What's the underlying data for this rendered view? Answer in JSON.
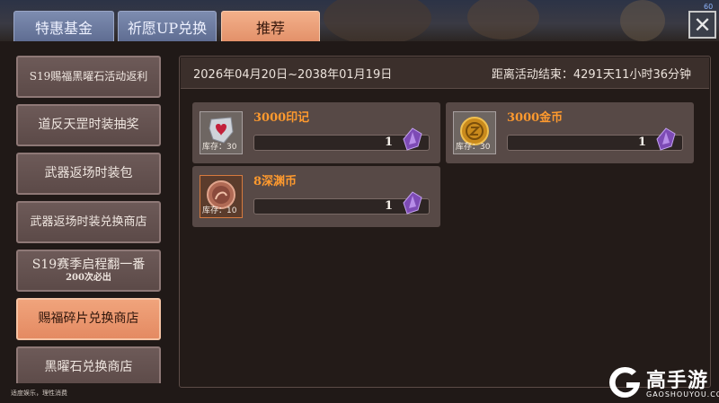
{
  "tabs": [
    {
      "label": "特惠基金",
      "active": false
    },
    {
      "label": "祈愿UP兑换",
      "active": false
    },
    {
      "label": "推荐",
      "active": true
    }
  ],
  "top_counter": "60",
  "sidebar": {
    "items": [
      {
        "label": "S19赐福黑曜石活动返利",
        "sub": ""
      },
      {
        "label": "道反天罡时装抽奖",
        "sub": ""
      },
      {
        "label": "武器返场时装包",
        "sub": ""
      },
      {
        "label": "武器返场时装兑换商店",
        "sub": ""
      },
      {
        "label": "S19赛季启程翻一番",
        "sub": "200次必出"
      },
      {
        "label": "赐福碎片兑换商店",
        "sub": "",
        "active": true
      },
      {
        "label": "黑曜石兑换商店",
        "sub": ""
      }
    ]
  },
  "footer_note": "适度娱乐，理性消费",
  "event": {
    "date_range": "2026年04月20日~2038年01月19日",
    "countdown": "距离活动结束：4291天11小时36分钟"
  },
  "rewards": [
    {
      "name": "3000印记",
      "stock": "库存：30",
      "quantity": "1",
      "icon": "seal-emblem-icon"
    },
    {
      "name": "3000金币",
      "stock": "库存：30",
      "quantity": "1",
      "icon": "gold-coin-icon"
    },
    {
      "name": "8深渊币",
      "stock": "库存：10",
      "quantity": "1",
      "icon": "abyss-coin-icon"
    }
  ],
  "brand": {
    "name": "高手游",
    "url": "GAOSHOUYOU.COM"
  },
  "colors": {
    "accent_tab": "#e8956c",
    "item_name": "#ff9a2e",
    "inactive_tab": "#6e7ca2"
  }
}
